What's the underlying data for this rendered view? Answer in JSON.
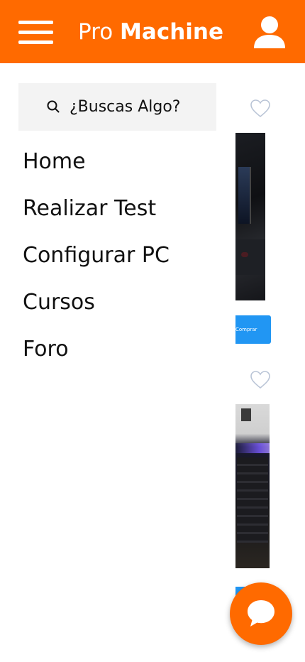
{
  "header": {
    "logo_light": "Pro",
    "logo_bold": "Machine",
    "menu_icon": "hamburger-menu-icon",
    "user_icon": "user-icon"
  },
  "drawer": {
    "search_placeholder": "¿Buscas Algo?",
    "search_icon": "search-icon",
    "nav": [
      {
        "label": "Home"
      },
      {
        "label": "Realizar Test"
      },
      {
        "label": "Configurar PC"
      },
      {
        "label": "Cursos"
      },
      {
        "label": "Foro"
      }
    ]
  },
  "products": [
    {
      "favorite_icon": "heart-outline-icon",
      "buy_label": "Comprar"
    },
    {
      "favorite_icon": "heart-outline-icon"
    }
  ],
  "chat": {
    "icon": "chat-bubble-icon"
  },
  "colors": {
    "brand": "#ff6a00",
    "button": "#2196f3",
    "search_bg": "#f3f3f3"
  }
}
